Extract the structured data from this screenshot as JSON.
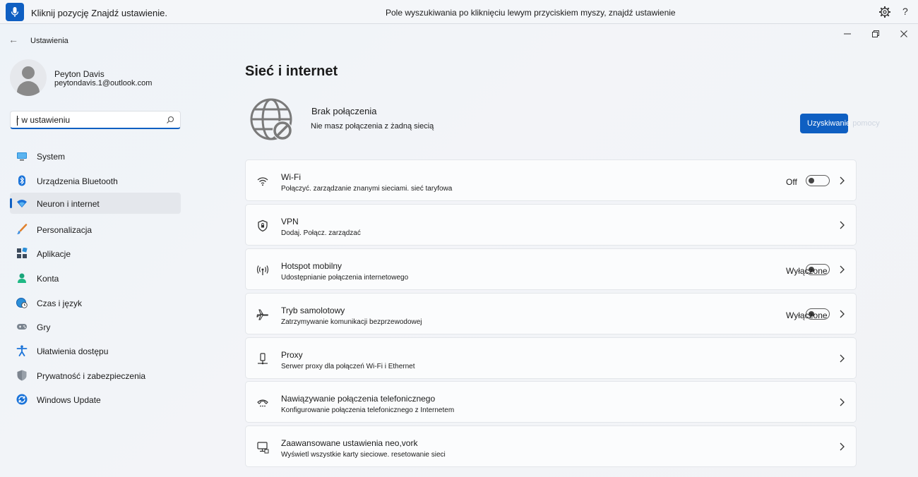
{
  "voice_bar": {
    "message": "Kliknij pozycję Znajdź ustawienie.",
    "hint": "Pole wyszukiwania po kliknięciu lewym przyciskiem myszy, znajdź ustawienie",
    "help": "?"
  },
  "window": {
    "title": "Ustawienia"
  },
  "user": {
    "name": "Peyton Davis",
    "email": "peytondavis.1@outlook.com"
  },
  "search": {
    "value": "r w ustawieniu"
  },
  "nav": [
    {
      "label": "System",
      "icon": "monitor-icon"
    },
    {
      "label": "Urządzenia Bluetooth",
      "icon": "bluetooth-icon"
    },
    {
      "label": "Neuron i internet",
      "icon": "wifi-icon",
      "active": true
    },
    {
      "label": "Personalizacja",
      "icon": "brush-icon"
    },
    {
      "label": "Aplikacje",
      "icon": "apps-icon"
    },
    {
      "label": "Konta",
      "icon": "person-icon"
    },
    {
      "label": "Czas i język",
      "icon": "globe-clock-icon"
    },
    {
      "label": "Gry",
      "icon": "gamepad-icon"
    },
    {
      "label": "Ułatwienia dostępu",
      "icon": "accessibility-icon"
    },
    {
      "label": "Prywatność i zabezpieczenia",
      "icon": "shield-icon"
    },
    {
      "label": "Windows Update",
      "icon": "update-icon"
    }
  ],
  "main": {
    "title": "Sieć i internet",
    "status_title": "Brak połączenia",
    "status_sub": "Nie masz połączenia z żadną siecią",
    "help_button": "Uzyskiwanie",
    "help_button_tail": " pomocy"
  },
  "cards": [
    {
      "title": "Wi-Fi",
      "sub": "Połączyć. zarządzanie znanymi sieciami. sieć taryfowa",
      "state": "Off",
      "toggle": false,
      "icon": "wifi-icon"
    },
    {
      "title": "VPN",
      "sub": "Dodaj. Połącz. zarządzać",
      "icon": "vpn-shield-icon"
    },
    {
      "title": "Hotspot mobilny",
      "sub": "Udostępnianie połączenia internetowego",
      "state": "Wyłączone",
      "toggle": false,
      "icon": "hotspot-icon"
    },
    {
      "title": "Tryb samolotowy",
      "sub": "Zatrzymywanie komunikacji bezprzewodowej",
      "state": "Wyłączone",
      "toggle": false,
      "icon": "airplane-icon"
    },
    {
      "title": "Proxy",
      "sub": "Serwer proxy dla połączeń Wi-Fi i Ethernet",
      "icon": "proxy-icon"
    },
    {
      "title": "Nawiązywanie połączenia telefonicznego",
      "sub": "Konfigurowanie połączenia telefonicznego z Internetem",
      "icon": "dialup-icon"
    },
    {
      "title": "Zaawansowane ustawienia neo,vork",
      "sub": "Wyświetl wszystkie karty sieciowe. resetowanie sieci",
      "icon": "network-monitor-icon"
    }
  ],
  "colors": {
    "accent": "#0f5fc2",
    "background": "#f1f3f6",
    "card": "#fbfcfd"
  }
}
